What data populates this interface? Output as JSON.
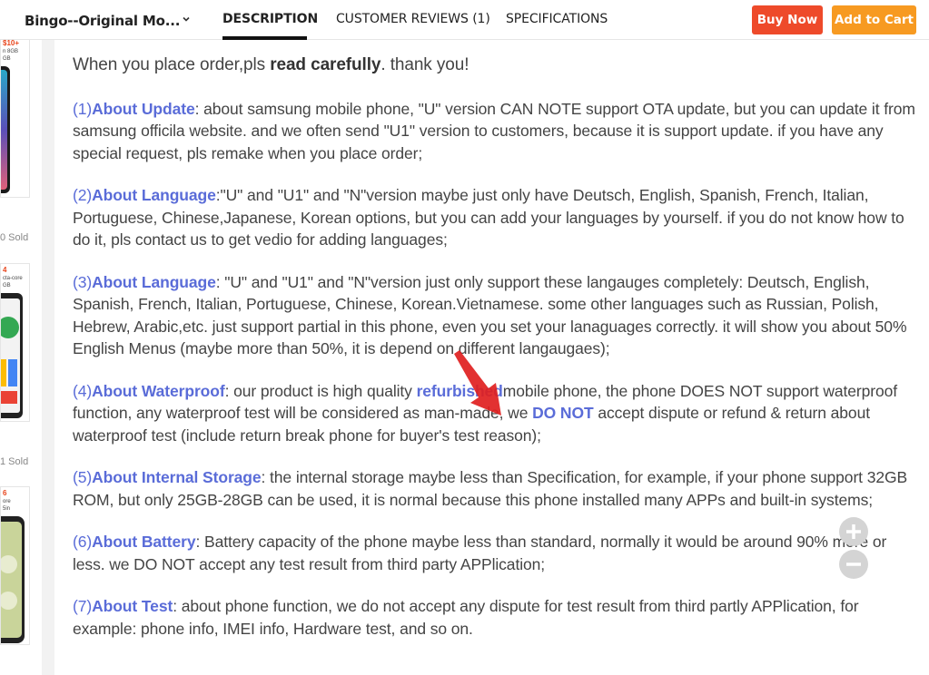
{
  "header": {
    "store_name": "Bingo--Original Mo...",
    "tabs": [
      {
        "label": "DESCRIPTION"
      },
      {
        "label": "CUSTOMER REVIEWS (1)"
      },
      {
        "label": "SPECIFICATIONS"
      }
    ],
    "buy_now": "Buy Now",
    "add_to_cart": "Add to Cart"
  },
  "sidebar": {
    "products": [
      {
        "badge": "$10+",
        "sub1": "n 8GB",
        "sub2": "GB"
      },
      {
        "badge": "4",
        "sub1": "cta-core",
        "sub2": "GB"
      },
      {
        "badge": "6",
        "sub1": "ore",
        "sub2": "5in"
      }
    ],
    "sold": [
      "0 Sold",
      "1 Sold"
    ]
  },
  "description": {
    "intro_pre": "When you place order,pls ",
    "intro_bold": "read carefully",
    "intro_post": ". thank you!",
    "items": [
      {
        "num": "(1)",
        "title": "About Update",
        "text": ": about samsung mobile phone, \"U\" version CAN NOTE support OTA update, but you can update it from samsung officila website. and we often send \"U1\" version to customers, because it is support update. if you have any special request, pls remake when you place order;"
      },
      {
        "num": "(2)",
        "title": "About Language",
        "text": ":\"U\" and \"U1\" and \"N\"version maybe just only have Deutsch, English, Spanish, French, Italian, Portuguese, Chinese,Japanese, Korean options, but you can add your languages by yourself. if you do not know how to do it, pls contact us to get vedio for adding languages;"
      },
      {
        "num": "(3)",
        "title": "About Language",
        "text": ": \"U\" and \"U1\" and \"N\"version just only support these langauges completely: Deutsch, English, Spanish, French, Italian, Portuguese, Chinese, Korean.Vietnamese. some other languages such as Russian, Polish, Hebrew, Arabic,etc. just support partial in this phone, even you set your lanaguages correctly. it will show you about 50% English Menus (maybe more than 50%, it is depend on different langaugaes);"
      },
      {
        "num": "(4)",
        "title": "About Waterproof",
        "text_a": ": our product is high quality ",
        "highlight_a": "refurbished",
        "text_b": "mobile phone, the phone DOES NOT support waterproof function, any waterproof test will be considered as man-made, we ",
        "highlight_b": "DO NOT",
        "text_c": " accept dispute or refund & return about waterproof test (include return break phone for buyer's test reason);"
      },
      {
        "num": "(5)",
        "title": "About Internal Storage",
        "text": ": the internal storage maybe less than Specification, for example, if your phone support 32GB ROM, but only 25GB-28GB can be used, it is normal because this phone installed many APPs and built-in systems;"
      },
      {
        "num": "(6)",
        "title": "About Battery",
        "text": ": Battery capacity of the phone maybe less than standard, normally it would be around 90% more or less. we DO NOT accept any test result from third party APPlication;"
      },
      {
        "num": "(7)",
        "title": "About Test",
        "text": ": about phone function, we do not accept any dispute for test result from third partly APPlication, for example: phone info, IMEI info, Hardware test, and so on."
      }
    ]
  },
  "colors": {
    "accent": "#5a6cd8",
    "buy_now_bg": "#ee4a2a",
    "add_to_cart_bg": "#f79a21",
    "arrow": "#e02020"
  },
  "icons": [
    "chevron-down-icon",
    "arrow-annotation-icon",
    "zoom-in-icon",
    "zoom-out-icon"
  ]
}
